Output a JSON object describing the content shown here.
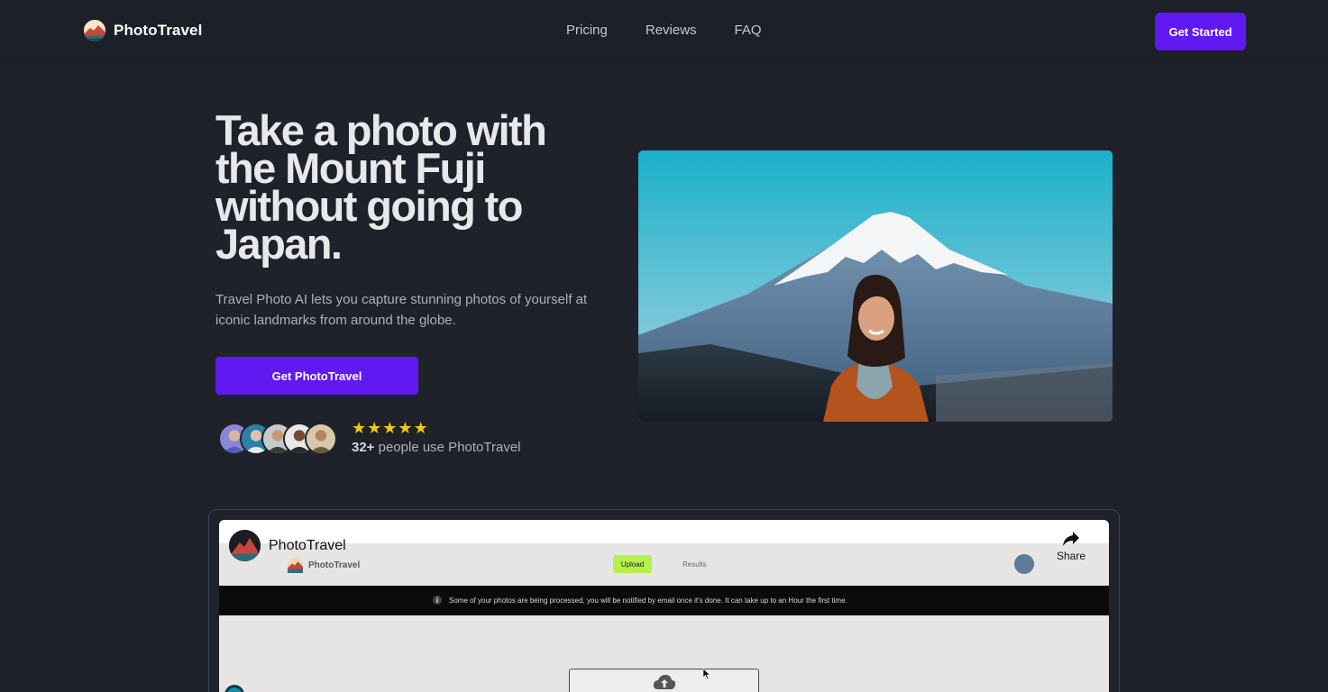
{
  "header": {
    "brand": "PhotoTravel",
    "nav": [
      "Pricing",
      "Reviews",
      "FAQ"
    ],
    "cta": "Get Started"
  },
  "hero": {
    "title": "Take a photo with the Mount Fuji without going to Japan.",
    "subtitle": "Travel Photo AI lets you capture stunning photos of yourself at iconic landmarks from around the globe.",
    "cta": "Get PhotoTravel",
    "rating": 5,
    "user_count": "32+",
    "user_text": " people use PhotoTravel"
  },
  "video": {
    "channel": "PhotoTravel",
    "share_label": "Share",
    "app_brand": "PhotoTravel",
    "upload_label": "Upload",
    "results_label": "Results",
    "banner": "Some of your photos are being processed, you will be notified by email once it's done. It can take up to an Hour the first time."
  },
  "colors": {
    "background": "#1f222b",
    "accent": "#6019f1",
    "star": "#f5c518",
    "upload_badge": "#b6f04d"
  },
  "icons": {
    "brand": "mountain-sunset-icon",
    "share": "share-arrow-icon",
    "upload": "cloud-upload-icon",
    "star": "star-icon"
  }
}
